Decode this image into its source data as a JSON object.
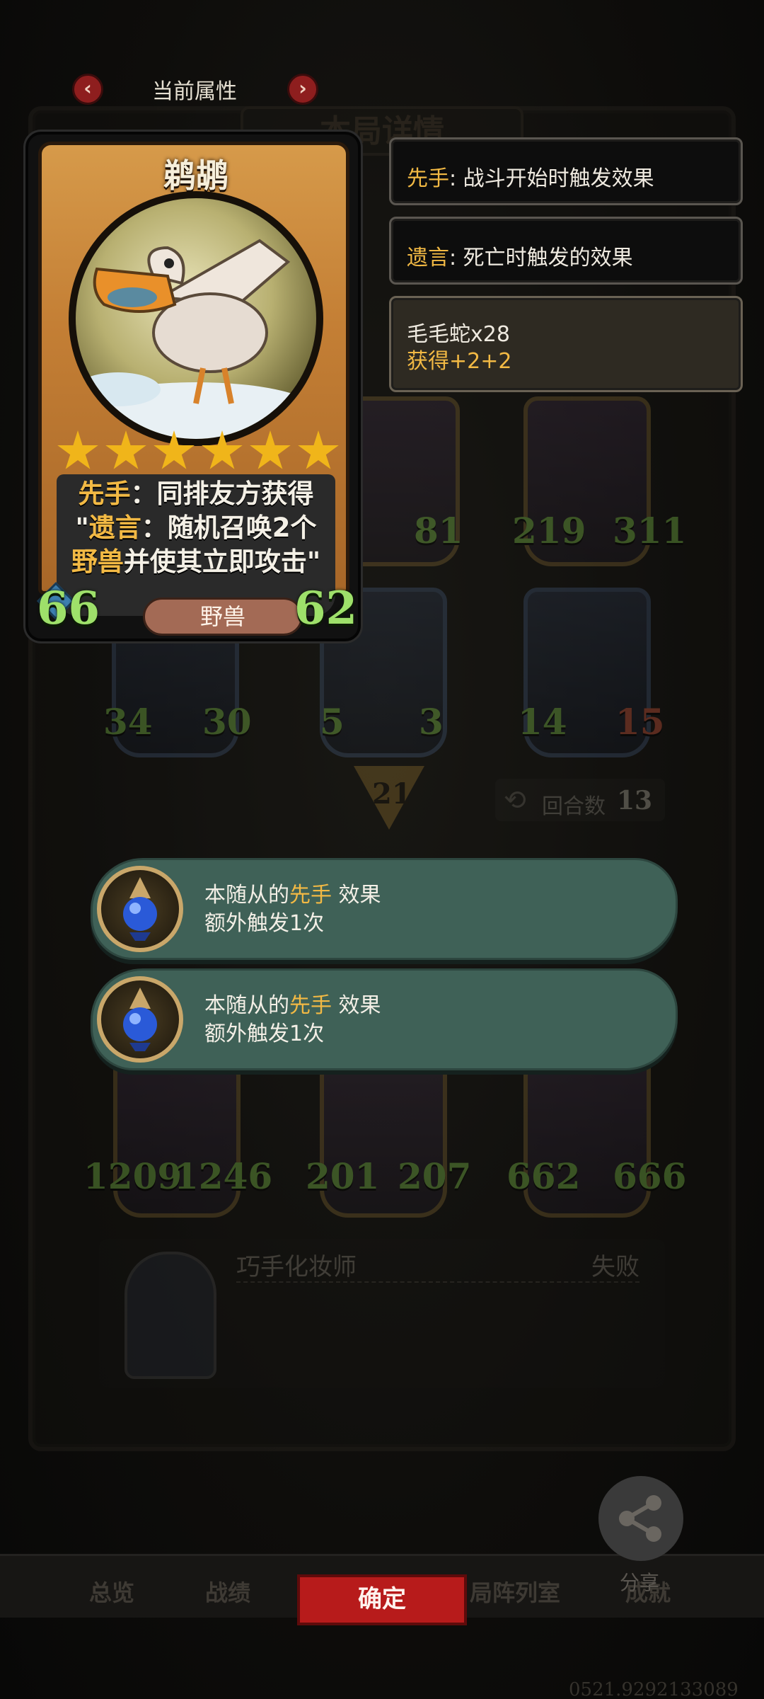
{
  "header": {
    "title": "当前属性",
    "prev_arrow": "‹",
    "next_arrow": "›"
  },
  "background": {
    "panel_title": "本局详情",
    "round_label": "回合数",
    "round_value": "13",
    "arrow_value": "21",
    "row1": [
      {
        "attack": "",
        "health": "81"
      },
      {
        "attack": "219",
        "health": "311"
      }
    ],
    "row2": [
      {
        "attack": "34",
        "health": "30"
      },
      {
        "attack": "5",
        "health": "3"
      },
      {
        "attack": "14",
        "health": "15"
      }
    ],
    "row3": [
      {
        "attack": "1209",
        "health": "1246"
      },
      {
        "attack": "201",
        "health": "207"
      },
      {
        "attack": "662",
        "health": "666"
      }
    ],
    "opponent_name": "巧手化妆师",
    "result": "失败"
  },
  "card": {
    "name": "鹈鹕",
    "stars": 6,
    "desc_line1_kw": "先手",
    "desc_line1_rest": "：同排友方获得",
    "desc_line2_pre": "\"",
    "desc_line2_kw": "遗言",
    "desc_line2_rest": "：随机召唤2个",
    "desc_line3_kw": "野兽",
    "desc_line3_rest": "并使其立即攻击\"",
    "attack": "66",
    "health": "62",
    "type": "野兽"
  },
  "keywords": [
    {
      "kw": "先手",
      "sep": ": ",
      "text": "战斗开始时触发效果"
    },
    {
      "kw": "遗言",
      "sep": ": ",
      "text": "死亡时触发的效果"
    }
  ],
  "tooltip": {
    "line1": "毛毛蛇x28",
    "line2_prefix": "获得",
    "line2_value": "+2+2"
  },
  "toasts": [
    {
      "pre": "本随从的",
      "kw": "先手",
      "post": "效果",
      "line2": "额外触发1次"
    },
    {
      "pre": "本随从的",
      "kw": "先手",
      "post": "效果",
      "line2": "额外触发1次"
    }
  ],
  "tabs": [
    "总览",
    "战绩",
    "局阵列室",
    "成就"
  ],
  "confirm_label": "确定",
  "share_label": "分享",
  "bottom_code": "0521.9292133089",
  "colors": {
    "keyword": "#f2b944",
    "stat_green": "#9ee06a",
    "confirm_red": "#b71b1b",
    "toast_teal": "#3f6157"
  }
}
